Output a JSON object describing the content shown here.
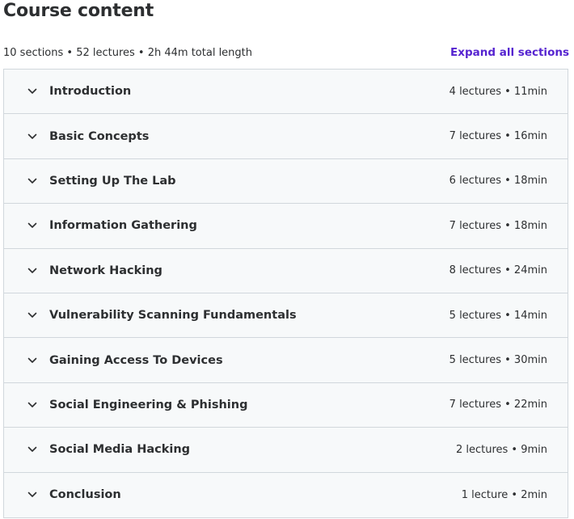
{
  "header": {
    "title": "Course content",
    "summary": "10 sections • 52 lectures • 2h 44m total length",
    "expand_label": "Expand all sections"
  },
  "sections": [
    {
      "title": "Introduction",
      "meta": "4 lectures • 11min"
    },
    {
      "title": "Basic Concepts",
      "meta": "7 lectures • 16min"
    },
    {
      "title": "Setting Up The Lab",
      "meta": "6 lectures • 18min"
    },
    {
      "title": "Information Gathering",
      "meta": "7 lectures • 18min"
    },
    {
      "title": "Network Hacking",
      "meta": "8 lectures • 24min"
    },
    {
      "title": "Vulnerability Scanning Fundamentals",
      "meta": "5 lectures • 14min"
    },
    {
      "title": "Gaining Access To Devices",
      "meta": "5 lectures • 30min"
    },
    {
      "title": "Social Engineering & Phishing",
      "meta": "7 lectures • 22min"
    },
    {
      "title": "Social Media Hacking",
      "meta": "2 lectures • 9min"
    },
    {
      "title": "Conclusion",
      "meta": "1 lecture • 2min"
    }
  ],
  "colors": {
    "text": "#2d2f31",
    "link": "#5624d0",
    "row_bg": "#f7f9fa",
    "border": "#d1d7dc"
  },
  "icons": {
    "section_toggle": "chevron-down-icon"
  }
}
